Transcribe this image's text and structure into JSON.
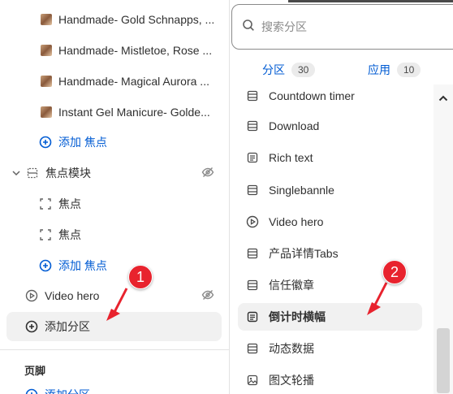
{
  "sidebar": {
    "items": [
      {
        "label": "Handmade- Gold Schnapps, ..."
      },
      {
        "label": "Handmade- Mistletoe, Rose ..."
      },
      {
        "label": "Handmade- Magical Aurora ..."
      },
      {
        "label": "Instant Gel Manicure- Golde..."
      }
    ],
    "add_focus_1": "添加 焦点",
    "focus_module": "焦点模块",
    "focus_a": "焦点",
    "focus_b": "焦点",
    "add_focus_2": "添加 焦点",
    "video_hero": "Video hero",
    "add_section": "添加分区",
    "footer_title": "页脚",
    "footer_add": "添加分区"
  },
  "picker": {
    "search_placeholder": "搜索分区",
    "tab_sections": "分区",
    "tab_sections_count": "30",
    "tab_apps": "应用",
    "tab_apps_count": "10",
    "items": [
      {
        "label": "Countdown timer",
        "icon": "layout-icon"
      },
      {
        "label": "Download",
        "icon": "layout-icon"
      },
      {
        "label": "Rich text",
        "icon": "text-block-icon"
      },
      {
        "label": "Singlebannle",
        "icon": "layout-icon"
      },
      {
        "label": "Video hero",
        "icon": "play-icon"
      },
      {
        "label": "产品详情Tabs",
        "icon": "layout-icon"
      },
      {
        "label": "信任徽章",
        "icon": "layout-icon"
      },
      {
        "label": "倒计时横幅",
        "icon": "text-block-icon"
      },
      {
        "label": "动态数据",
        "icon": "layout-icon"
      },
      {
        "label": "图文轮播",
        "icon": "image-icon"
      }
    ]
  },
  "annotations": {
    "marker_1": "1",
    "marker_2": "2"
  },
  "colors": {
    "accent": "#005bd3",
    "marker": "#e8232e"
  }
}
